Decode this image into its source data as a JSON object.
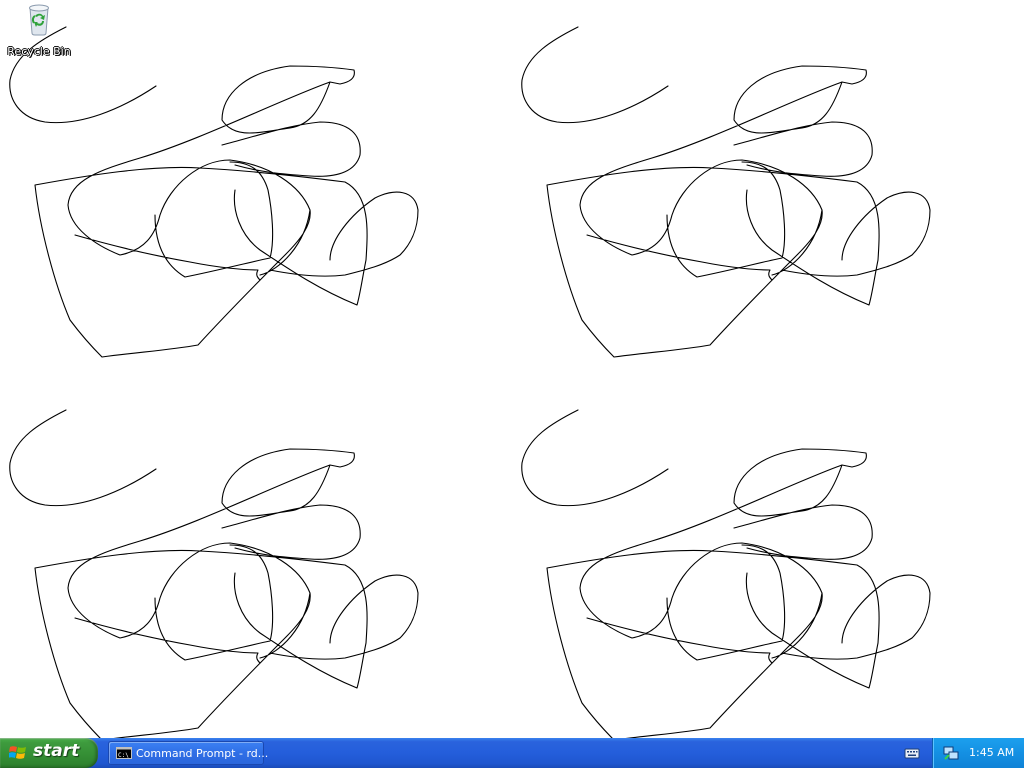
{
  "desktop": {
    "background": "#ffffff",
    "icons": [
      {
        "label": "Recycle Bin",
        "icon": "recycle-bin-icon"
      }
    ]
  },
  "taskbar": {
    "start_label": "start",
    "tasks": [
      {
        "label": "Command Prompt - rd...",
        "icon": "command-prompt-icon"
      }
    ],
    "tray": {
      "clock": "1:45 AM",
      "icons": [
        "keyboard-icon",
        "network-icon"
      ]
    },
    "colors": {
      "taskbar_blue": "#245edb",
      "start_green": "#3e9b3e",
      "tray_blue": "#1490e3"
    }
  }
}
